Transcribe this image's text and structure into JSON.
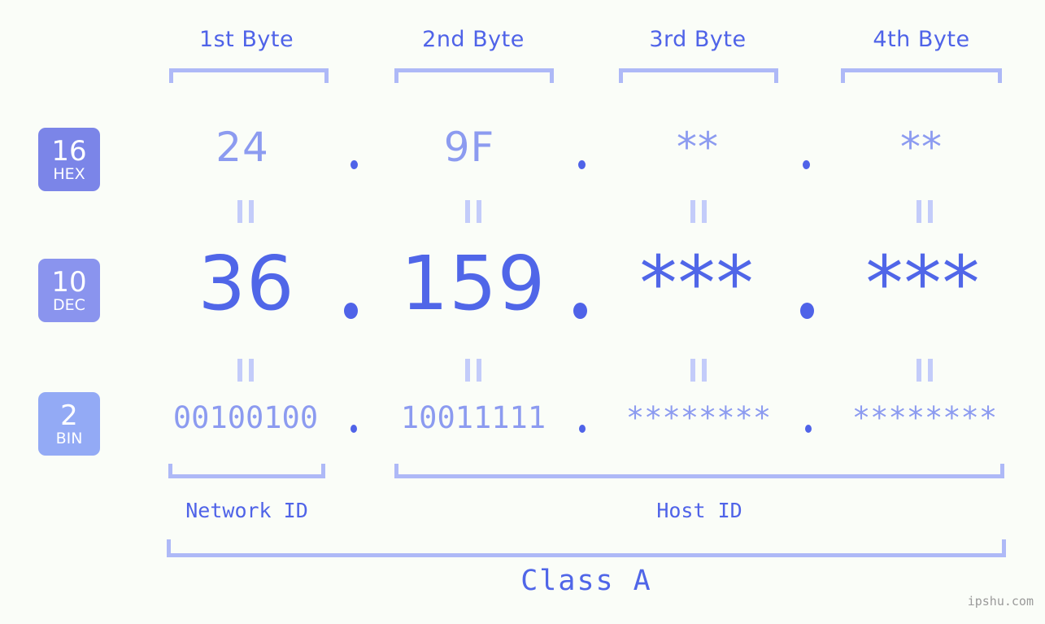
{
  "background_color": "#fafdf8",
  "accent_color": "#4f63e8",
  "muted_color": "#8c9bf0",
  "bracket_color": "#aeb9f7",
  "byte_headers": [
    {
      "label": "1st Byte"
    },
    {
      "label": "2nd Byte"
    },
    {
      "label": "3rd Byte"
    },
    {
      "label": "4th Byte"
    }
  ],
  "rows": [
    {
      "badge_number": "16",
      "badge_word": "HEX",
      "badge_color": "#7b85e8",
      "values": [
        "24",
        "9F",
        "**",
        "**"
      ],
      "separator": "."
    },
    {
      "badge_number": "10",
      "badge_word": "DEC",
      "badge_color": "#8a94ee",
      "values": [
        "36",
        "159",
        "***",
        "***"
      ],
      "separator": "."
    },
    {
      "badge_number": "2",
      "badge_word": "BIN",
      "badge_color": "#93aaf5",
      "values": [
        "00100100",
        "10011111",
        "********",
        "********"
      ],
      "separator": "."
    }
  ],
  "equality_marker": "||",
  "id_sections": [
    {
      "label": "Network ID"
    },
    {
      "label": "Host ID"
    }
  ],
  "class_label": "Class A",
  "watermark": "ipshu.com"
}
